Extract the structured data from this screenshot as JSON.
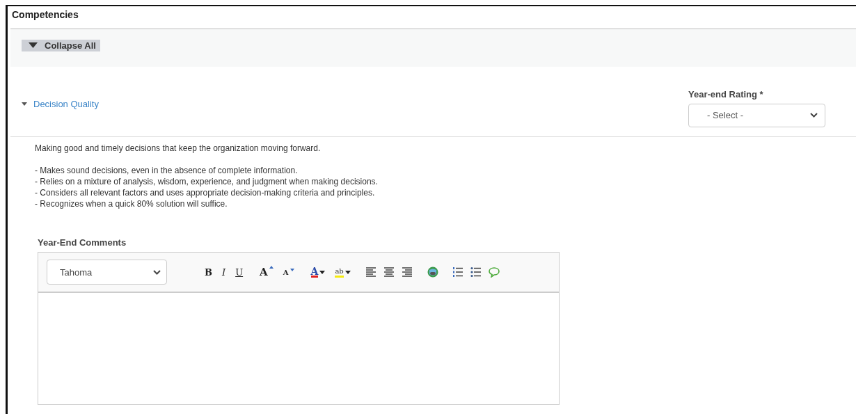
{
  "section": {
    "title": "Competencies"
  },
  "collapse_button": {
    "label": "Collapse All"
  },
  "competency": {
    "name": "Decision Quality",
    "expanded": true,
    "rating": {
      "label": "Year-end Rating *",
      "value": "- Select -"
    },
    "description": "Making good and timely decisions that keep the organization moving forward.",
    "bullets": [
      "- Makes sound decisions, even in the absence of complete information.",
      "- Relies on a mixture of analysis, wisdom, experience, and judgment when making decisions.",
      "- Considers all relevant factors and uses appropriate decision-making criteria and principles.",
      "- Recognizes when a quick 80% solution will suffice."
    ]
  },
  "comments": {
    "label": "Year-End Comments",
    "font": "Tahoma",
    "toolbar_groups": [
      [
        {
          "kind": "bold",
          "label": "B"
        },
        {
          "kind": "italic",
          "label": "I"
        },
        {
          "kind": "underline",
          "label": "U"
        }
      ],
      [
        {
          "kind": "grow",
          "label": "A"
        },
        {
          "kind": "shrink",
          "label": "A"
        }
      ],
      [
        {
          "kind": "font-color",
          "label": "A"
        },
        {
          "kind": "highlight",
          "label": "ab"
        }
      ],
      [
        {
          "kind": "align-left"
        },
        {
          "kind": "align-center"
        },
        {
          "kind": "align-right"
        }
      ],
      [
        {
          "kind": "link"
        }
      ],
      [
        {
          "kind": "ordered-list"
        },
        {
          "kind": "bullet-list"
        },
        {
          "kind": "comment"
        }
      ]
    ]
  }
}
